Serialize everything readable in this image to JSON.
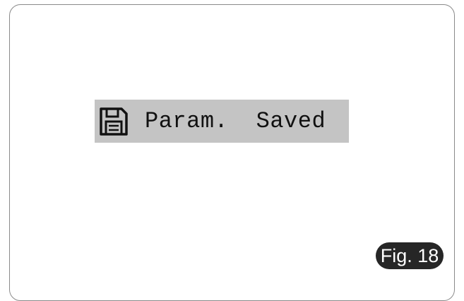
{
  "notification": {
    "icon": "save-icon",
    "message": "Param.  Saved",
    "background": "#c4c4c4"
  },
  "figure": {
    "label": "Fig. 18"
  }
}
